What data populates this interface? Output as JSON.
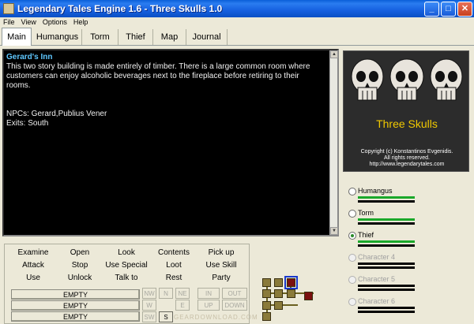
{
  "window": {
    "title": "Legendary Tales Engine 1.6 - Three Skulls 1.0",
    "minimize": "_",
    "maximize": "□",
    "close": "✕"
  },
  "menu": [
    "File",
    "View",
    "Options",
    "Help"
  ],
  "tabs": [
    "Main",
    "Humangus",
    "Torm",
    "Thief",
    "Map",
    "Journal"
  ],
  "location": {
    "name": "Gerard's Inn",
    "description": "This two story building is made entirely of timber. There is a large common room where customers can enjoy alcoholic beverages next to the fireplace before retiring to their rooms.",
    "npcs": "NPCs: Gerard,Publius Vener",
    "exits": "Exits: South"
  },
  "panel": {
    "title": "Three Skulls",
    "copyright_1": "Copyright (c) Konstantinos Evgenidis.",
    "copyright_2": "All rights reserved.",
    "copyright_3": "http://www.legendarytales.com"
  },
  "characters": [
    {
      "name": "Humangus",
      "enabled": true,
      "selected": false,
      "health": 1.0
    },
    {
      "name": "Torm",
      "enabled": true,
      "selected": false,
      "health": 1.0
    },
    {
      "name": "Thief",
      "enabled": true,
      "selected": true,
      "health": 1.0
    },
    {
      "name": "Character 4",
      "enabled": false,
      "selected": false,
      "health": 0
    },
    {
      "name": "Character 5",
      "enabled": false,
      "selected": false,
      "health": 0
    },
    {
      "name": "Character 6",
      "enabled": false,
      "selected": false,
      "health": 0
    }
  ],
  "commands": [
    [
      "Examine",
      "Open",
      "Look",
      "Contents",
      "Pick up"
    ],
    [
      "Attack",
      "Stop",
      "Use Special",
      "Loot",
      "Use Skill"
    ],
    [
      "Use",
      "Unlock",
      "Talk to",
      "Rest",
      "Party"
    ]
  ],
  "inventory": [
    "EMPTY",
    "EMPTY",
    "EMPTY"
  ],
  "directions": {
    "nw": "NW",
    "n": "N",
    "ne": "NE",
    "in": "IN",
    "out": "OUT",
    "w": "W",
    "e": "E",
    "up": "UP",
    "down": "DOWN",
    "sw": "SW",
    "s": "S"
  },
  "watermark": "GEARDOWNLOAD.COM",
  "colors": {
    "health": "#1aa82a",
    "location_name": "#5fc8ff",
    "panel_title": "#f0c800"
  }
}
